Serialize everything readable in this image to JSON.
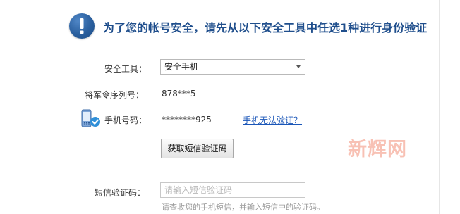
{
  "notice": {
    "icon": "exclamation-circle-icon",
    "text": "为了您的帐号安全，请先从以下安全工具中任选1种进行身份验证"
  },
  "form": {
    "security_tool": {
      "label": "安全工具：",
      "selected": "安全手机"
    },
    "token_serial": {
      "label": "将军令序列号：",
      "value": "878***5"
    },
    "phone": {
      "icon": "mobile-phone-check-icon",
      "label": "手机号码：",
      "value": "********925",
      "link": "手机无法验证？"
    },
    "get_code_button": "获取短信验证码",
    "sms_code": {
      "label": "短信验证码：",
      "placeholder": "请输入短信验证码",
      "hint": "请查收您的手机短信，并输入短信中的验证码。"
    }
  },
  "watermark": "新辉网",
  "colors": {
    "accent": "#1f4e8c",
    "link": "#1a56b8",
    "watermark": "#f7b7a8"
  }
}
